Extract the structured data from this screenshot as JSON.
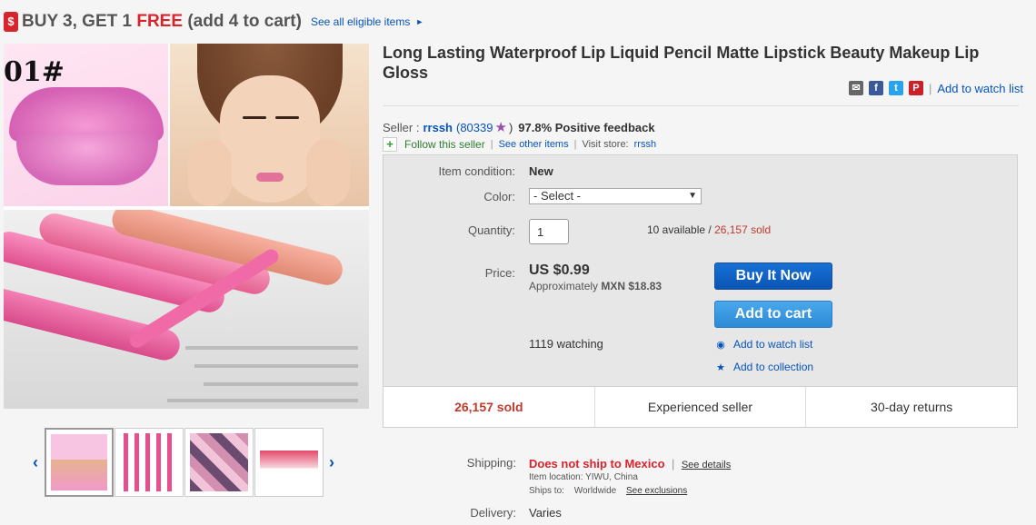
{
  "promo": {
    "tag": "$",
    "prefix": "BUY 3, GET 1 ",
    "free": "FREE",
    "suffix": " (add 4 to cart)",
    "link": "See all eligible items",
    "arrow": "►"
  },
  "gallery": {
    "overlay_number": "01#",
    "prev_arrow": "‹",
    "next_arrow": "›",
    "thumbnail_count": 4
  },
  "item": {
    "title": "Long Lasting Waterproof Lip Liquid Pencil Matte Lipstick Beauty Makeup Lip Gloss"
  },
  "share": {
    "watch_link": "Add to watch list",
    "separator": "|"
  },
  "seller": {
    "label": "Seller :",
    "name": "rrssh",
    "score": "(80339",
    "score_close": ")",
    "feedback": "97.8% Positive feedback",
    "follow": "Follow this seller",
    "see_other": "See other items",
    "visit_label": "Visit store:",
    "store": "rrssh"
  },
  "buybox": {
    "condition_label": "Item condition:",
    "condition_value": "New",
    "color_label": "Color:",
    "color_selected": "- Select -",
    "quantity_label": "Quantity:",
    "quantity_value": "1",
    "available": "10 available / ",
    "sold_count": "26,157 sold",
    "price_label": "Price:",
    "price": "US $0.99",
    "approx_label": "Approximately ",
    "approx_value": "MXN $18.83",
    "buy_now": "Buy It Now",
    "add_to_cart": "Add to cart",
    "watching": "1119 watching",
    "add_watch": "Add to watch list",
    "add_collection": "Add to collection"
  },
  "stats": [
    "26,157 sold",
    "Experienced seller",
    "30-day returns"
  ],
  "shipping": {
    "label": "Shipping:",
    "value": "Does not ship to Mexico",
    "see_details": "See details",
    "location_label": "Item location:",
    "location": "YIWU, China",
    "ships_to_label": "Ships to:",
    "ships_to": "Worldwide",
    "see_exclusions": "See exclusions",
    "delivery_label": "Delivery:",
    "delivery": "Varies"
  },
  "colors": {
    "link": "#0654ba",
    "alert_red": "#d9232d",
    "sold_red": "#c0392b",
    "buy_button": "#0a55b5",
    "cart_button": "#3a9be2"
  }
}
